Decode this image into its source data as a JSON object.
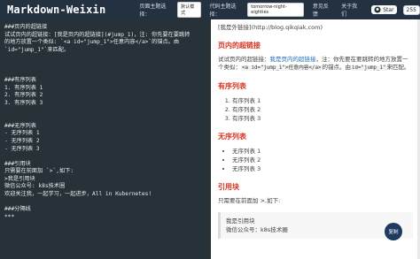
{
  "header": {
    "brand": "Markdown-Weixin",
    "page_theme_label": "页面主题选择：",
    "page_theme_value": "默认模式",
    "code_theme_label": "代码主题选择：",
    "code_theme_value": "tomorrow-night-eighties",
    "feedback": "意见反馈",
    "about": "关于我们",
    "star_label": "Star",
    "star_count": "255"
  },
  "editor": {
    "lines": [
      "###页内的超链接",
      "试试页内的超链接：[我是页内的超链接](#jump_1)，注: 你先要在要跳转",
      "的地方放置一个类似: `<a id=\"jump_1\">任意内容</a>`的锚点。由",
      "`id=\"jump_1\"`来匹配。",
      "",
      "",
      "",
      "###有序列表",
      "1. 有序列表 1",
      "2. 有序列表 2",
      "3. 有序列表 3",
      "",
      "",
      "###无序列表",
      "- 无序列表 1",
      "- 无序列表 2",
      "- 无序列表 3",
      "",
      "###引用块",
      "只需要在前面加 `>`,如下:",
      ">我是引用块",
      "微信公众号: k8s技术圈",
      "欢迎关注我，一起学习，一起进步，All in Kubernetes!",
      "",
      "###分隔线",
      "***"
    ]
  },
  "preview": {
    "top_line": "[我是外链接](http://blog.qikqiak.com)",
    "h_link": "页内的超链接",
    "p_link_1": "试试页内的超链接：",
    "p_link_anchor": "我是页内的超链接",
    "p_link_2": "，注：你先要在要跳转的地方放置一个类似：",
    "p_link_code": "<a id=\"jump_1\">任意内容</a>",
    "p_link_3": "的锚点。由",
    "p_link_code2": "id=\"jump_1\"",
    "p_link_4": "来匹配。",
    "h_ol": "有序列表",
    "ol": [
      "有序列表 1",
      "有序列表 2",
      "有序列表 3"
    ],
    "h_ul": "无序列表",
    "ul": [
      "无序列表 1",
      "无序列表 2",
      "无序列表 3"
    ],
    "h_quote": "引用块",
    "quote_intro": "只需要在前面加 >,如下:",
    "quote_lines": [
      "我是引用块",
      "微信公众号：k8s技术圈"
    ],
    "copy_button": "复制"
  }
}
